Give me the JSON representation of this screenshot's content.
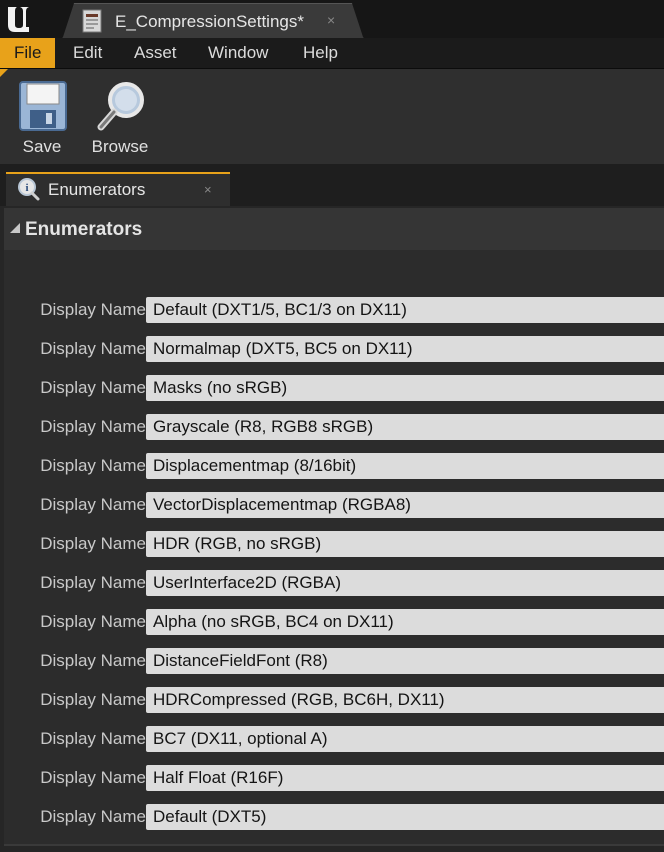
{
  "window": {
    "tab_title": "E_CompressionSettings*",
    "close_glyph": "×",
    "logo_icon": "unreal-engine-logo",
    "tab_icon": "enum-asset-icon"
  },
  "menu": {
    "items": [
      "File",
      "Edit",
      "Asset",
      "Window",
      "Help"
    ],
    "active": "File"
  },
  "toolbar": {
    "save_label": "Save",
    "save_icon": "floppy-disk-icon",
    "browse_label": "Browse",
    "browse_icon": "magnifying-glass-icon"
  },
  "panel": {
    "tab_label": "Enumerators",
    "tab_icon": "info-magnifier-icon",
    "close_glyph": "×",
    "section_title": "Enumerators"
  },
  "enumerators": [
    {
      "label": "Display Name",
      "value": "Default (DXT1/5, BC1/3 on DX11)"
    },
    {
      "label": "Display Name",
      "value": "Normalmap (DXT5, BC5 on DX11)"
    },
    {
      "label": "Display Name",
      "value": "Masks (no sRGB)"
    },
    {
      "label": "Display Name",
      "value": "Grayscale (R8, RGB8 sRGB)"
    },
    {
      "label": "Display Name",
      "value": "Displacementmap (8/16bit)"
    },
    {
      "label": "Display Name",
      "value": "VectorDisplacementmap (RGBA8)"
    },
    {
      "label": "Display Name",
      "value": "HDR (RGB, no sRGB)"
    },
    {
      "label": "Display Name",
      "value": "UserInterface2D (RGBA)"
    },
    {
      "label": "Display Name",
      "value": "Alpha (no sRGB, BC4 on DX11)"
    },
    {
      "label": "Display Name",
      "value": "DistanceFieldFont (R8)"
    },
    {
      "label": "Display Name",
      "value": "HDRCompressed (RGB, BC6H, DX11)"
    },
    {
      "label": "Display Name",
      "value": "BC7 (DX11, optional A)"
    },
    {
      "label": "Display Name",
      "value": "Half Float (R16F)"
    },
    {
      "label": "Display Name",
      "value": "Default (DXT5)"
    }
  ],
  "colors": {
    "accent": "#e8a21a",
    "field_bg": "#dcdcdc",
    "panel_bg": "#2c2c2c"
  }
}
